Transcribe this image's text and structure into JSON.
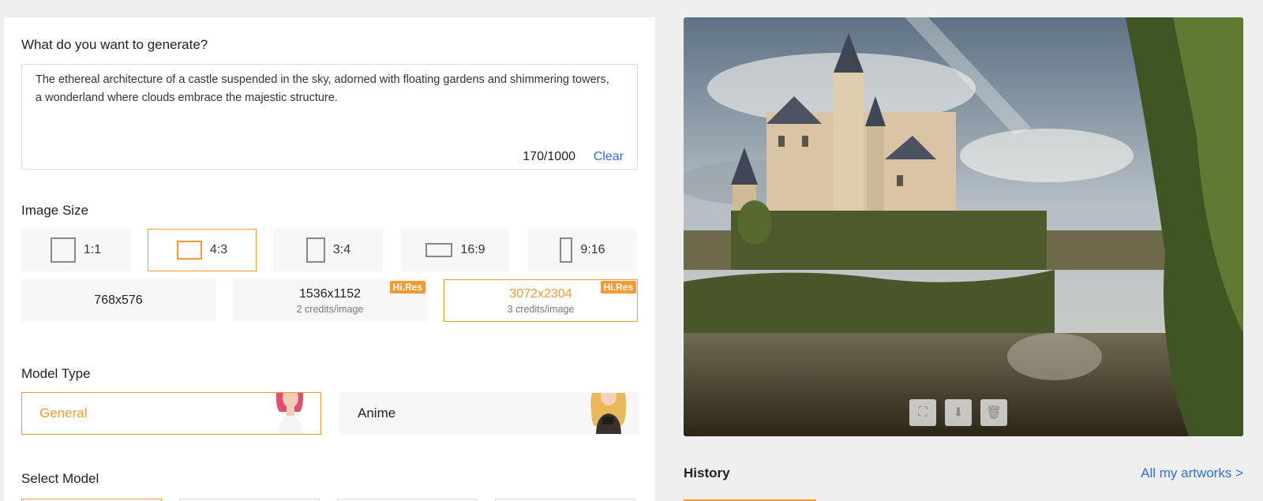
{
  "prompt": {
    "label": "What do you want to generate?",
    "text": "The ethereal architecture of a castle suspended in the sky, adorned with floating gardens and shimmering towers, a wonderland where clouds embrace the majestic structure.",
    "char_count": "170/1000",
    "clear_label": "Clear"
  },
  "image_size": {
    "label": "Image Size",
    "ratios": [
      "1:1",
      "4:3",
      "3:4",
      "16:9",
      "9:16"
    ],
    "selected_ratio": "4:3",
    "resolutions": [
      {
        "value": "768x576",
        "credits": "",
        "badge": ""
      },
      {
        "value": "1536x1152",
        "credits": "2 credits/image",
        "badge": "Hi.Res"
      },
      {
        "value": "3072x2304",
        "credits": "3 credits/image",
        "badge": "Hi.Res"
      }
    ],
    "selected_resolution": "3072x2304"
  },
  "model_type": {
    "label": "Model Type",
    "options": [
      "General",
      "Anime"
    ],
    "selected": "General"
  },
  "select_model": {
    "label": "Select Model"
  },
  "history": {
    "title": "History",
    "all_link": "All my artworks >"
  },
  "icons": {
    "fullscreen": "expand-icon",
    "download": "download-icon",
    "delete": "trash-icon"
  },
  "colors": {
    "accent": "#f39a34",
    "link": "#2f6fe0"
  }
}
